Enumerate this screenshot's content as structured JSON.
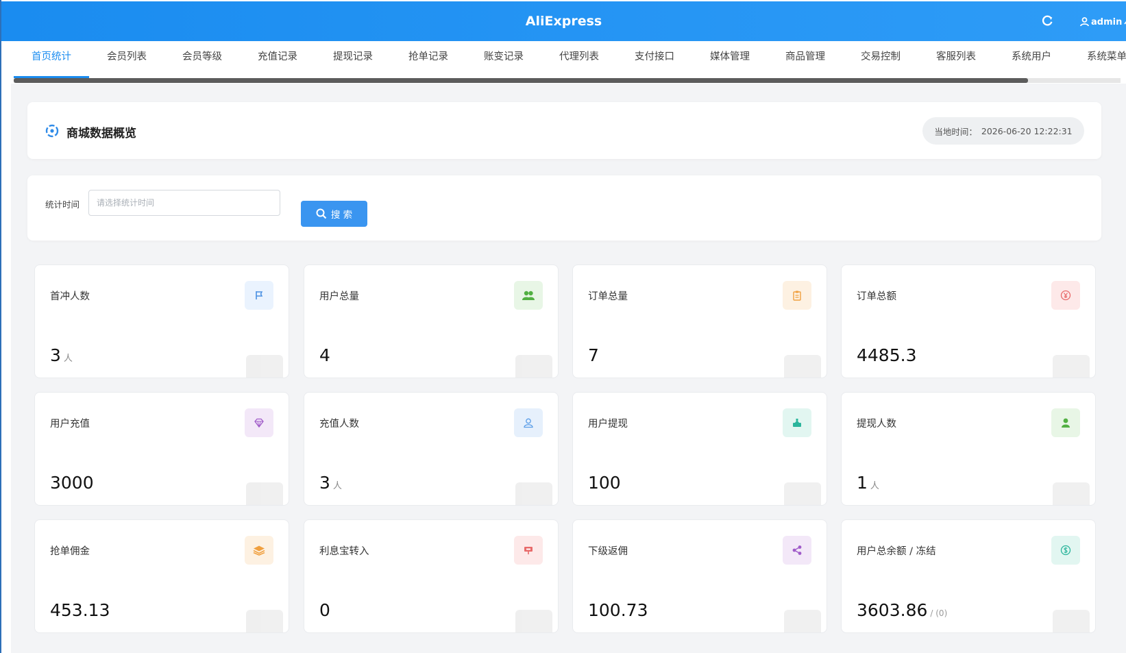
{
  "header": {
    "brand": "AliExpress",
    "user": "admin"
  },
  "tabs": [
    {
      "label": "首页统计",
      "active": true
    },
    {
      "label": "会员列表"
    },
    {
      "label": "会员等级"
    },
    {
      "label": "充值记录"
    },
    {
      "label": "提现记录"
    },
    {
      "label": "抢单记录"
    },
    {
      "label": "账变记录"
    },
    {
      "label": "代理列表"
    },
    {
      "label": "支付接口"
    },
    {
      "label": "媒体管理"
    },
    {
      "label": "商品管理"
    },
    {
      "label": "交易控制"
    },
    {
      "label": "客服列表"
    },
    {
      "label": "系统用户"
    },
    {
      "label": "系统菜单"
    }
  ],
  "overview": {
    "title": "商城数据概览",
    "time_label": "当地时间：",
    "time_value": "2026-06-20 12:22:31"
  },
  "filter": {
    "label": "统计时间",
    "placeholder": "请选择统计时间",
    "search_label": "搜 索"
  },
  "cards": [
    {
      "title": "首冲人数",
      "value": "3",
      "unit": "人",
      "icon": "flag-icon",
      "color": "#4a90e2",
      "bg": "#eaf3fe"
    },
    {
      "title": "用户总量",
      "value": "4",
      "icon": "users-icon",
      "color": "#52b043",
      "bg": "#e8f6e6"
    },
    {
      "title": "订单总量",
      "value": "7",
      "icon": "clipboard-icon",
      "color": "#f0a040",
      "bg": "#fdf1e2"
    },
    {
      "title": "订单总额",
      "value": "4485.3",
      "icon": "yen-icon",
      "color": "#e86a6a",
      "bg": "#fde9e9"
    },
    {
      "title": "用户充值",
      "value": "3000",
      "icon": "diamond-icon",
      "color": "#a05bc9",
      "bg": "#f3e8f8"
    },
    {
      "title": "充值人数",
      "value": "3",
      "unit": "人",
      "icon": "user-outline-icon",
      "color": "#5a9de8",
      "bg": "#e6f0fc"
    },
    {
      "title": "用户提现",
      "value": "100",
      "icon": "withdraw-icon",
      "color": "#2bb59c",
      "bg": "#e2f6f1"
    },
    {
      "title": "提现人数",
      "value": "1",
      "unit": "人",
      "icon": "user-solid-icon",
      "color": "#52b043",
      "bg": "#e8f6e6"
    },
    {
      "title": "抢单佣金",
      "value": "453.13",
      "icon": "layers-icon",
      "color": "#f0a040",
      "bg": "#fdf1e2"
    },
    {
      "title": "利息宝转入",
      "value": "0",
      "icon": "sign-icon",
      "color": "#e86a6a",
      "bg": "#fde9e9"
    },
    {
      "title": "下级返佣",
      "value": "100.73",
      "icon": "share-icon",
      "color": "#a05bc9",
      "bg": "#f3e8f8"
    },
    {
      "title": "用户总余额 / 冻结",
      "value": "3603.86",
      "extra": "/ (0)",
      "icon": "dollar-icon",
      "color": "#2bb59c",
      "bg": "#e2f6f1"
    }
  ]
}
